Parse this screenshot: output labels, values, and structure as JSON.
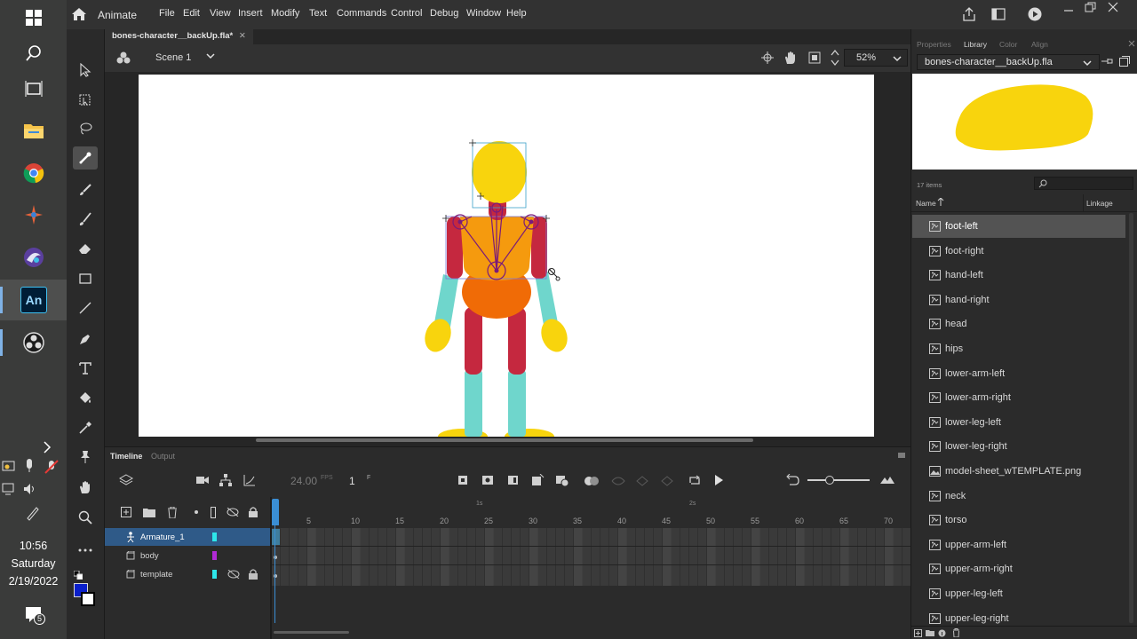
{
  "app": {
    "name": "Animate",
    "badge": "An"
  },
  "menu": [
    "File",
    "Edit",
    "View",
    "Insert",
    "Modify",
    "Text",
    "Commands",
    "Control",
    "Debug",
    "Window",
    "Help"
  ],
  "document": {
    "tab_title": "bones-character__backUp.fla*",
    "scene": "Scene 1",
    "zoom": "52%"
  },
  "taskbar": {
    "time": "10:56",
    "day": "Saturday",
    "date": "2/19/2022",
    "notification_count": "5"
  },
  "timeline": {
    "tabs": [
      "Timeline",
      "Output"
    ],
    "fps": "24.00",
    "fps_unit": "FPS",
    "current_frame": "1",
    "frame_unit": "F",
    "seconds_marks": [
      "1s",
      "2s"
    ],
    "frame_numbers": [
      "5",
      "10",
      "15",
      "20",
      "25",
      "30",
      "35",
      "40",
      "45",
      "50",
      "55",
      "60",
      "65",
      "70"
    ],
    "layers": [
      {
        "name": "Armature_1",
        "color": "#2ee6ea"
      },
      {
        "name": "body",
        "color": "#b12ad6"
      },
      {
        "name": "template",
        "color": "#2ee6ea"
      }
    ]
  },
  "panel": {
    "tabs": [
      "Properties",
      "Library",
      "Color",
      "Align"
    ],
    "library_file": "bones-character__backUp.fla",
    "items_count": "17 items",
    "columns": {
      "name": "Name",
      "linkage": "Linkage"
    },
    "items": [
      "foot-left",
      "foot-right",
      "hand-left",
      "hand-right",
      "head",
      "hips",
      "lower-arm-left",
      "lower-arm-right",
      "lower-leg-left",
      "lower-leg-right",
      "model-sheet_wTEMPLATE.png",
      "neck",
      "torso",
      "upper-arm-left",
      "upper-arm-right",
      "upper-leg-left",
      "upper-leg-right"
    ]
  },
  "colors": {
    "accent": "#2f5a88",
    "head": "#f8d40d",
    "torso": "#f59a0e",
    "hips": "#f06b06",
    "arms_upper": "#c5283f",
    "arms_lower": "#6fd6cc"
  }
}
